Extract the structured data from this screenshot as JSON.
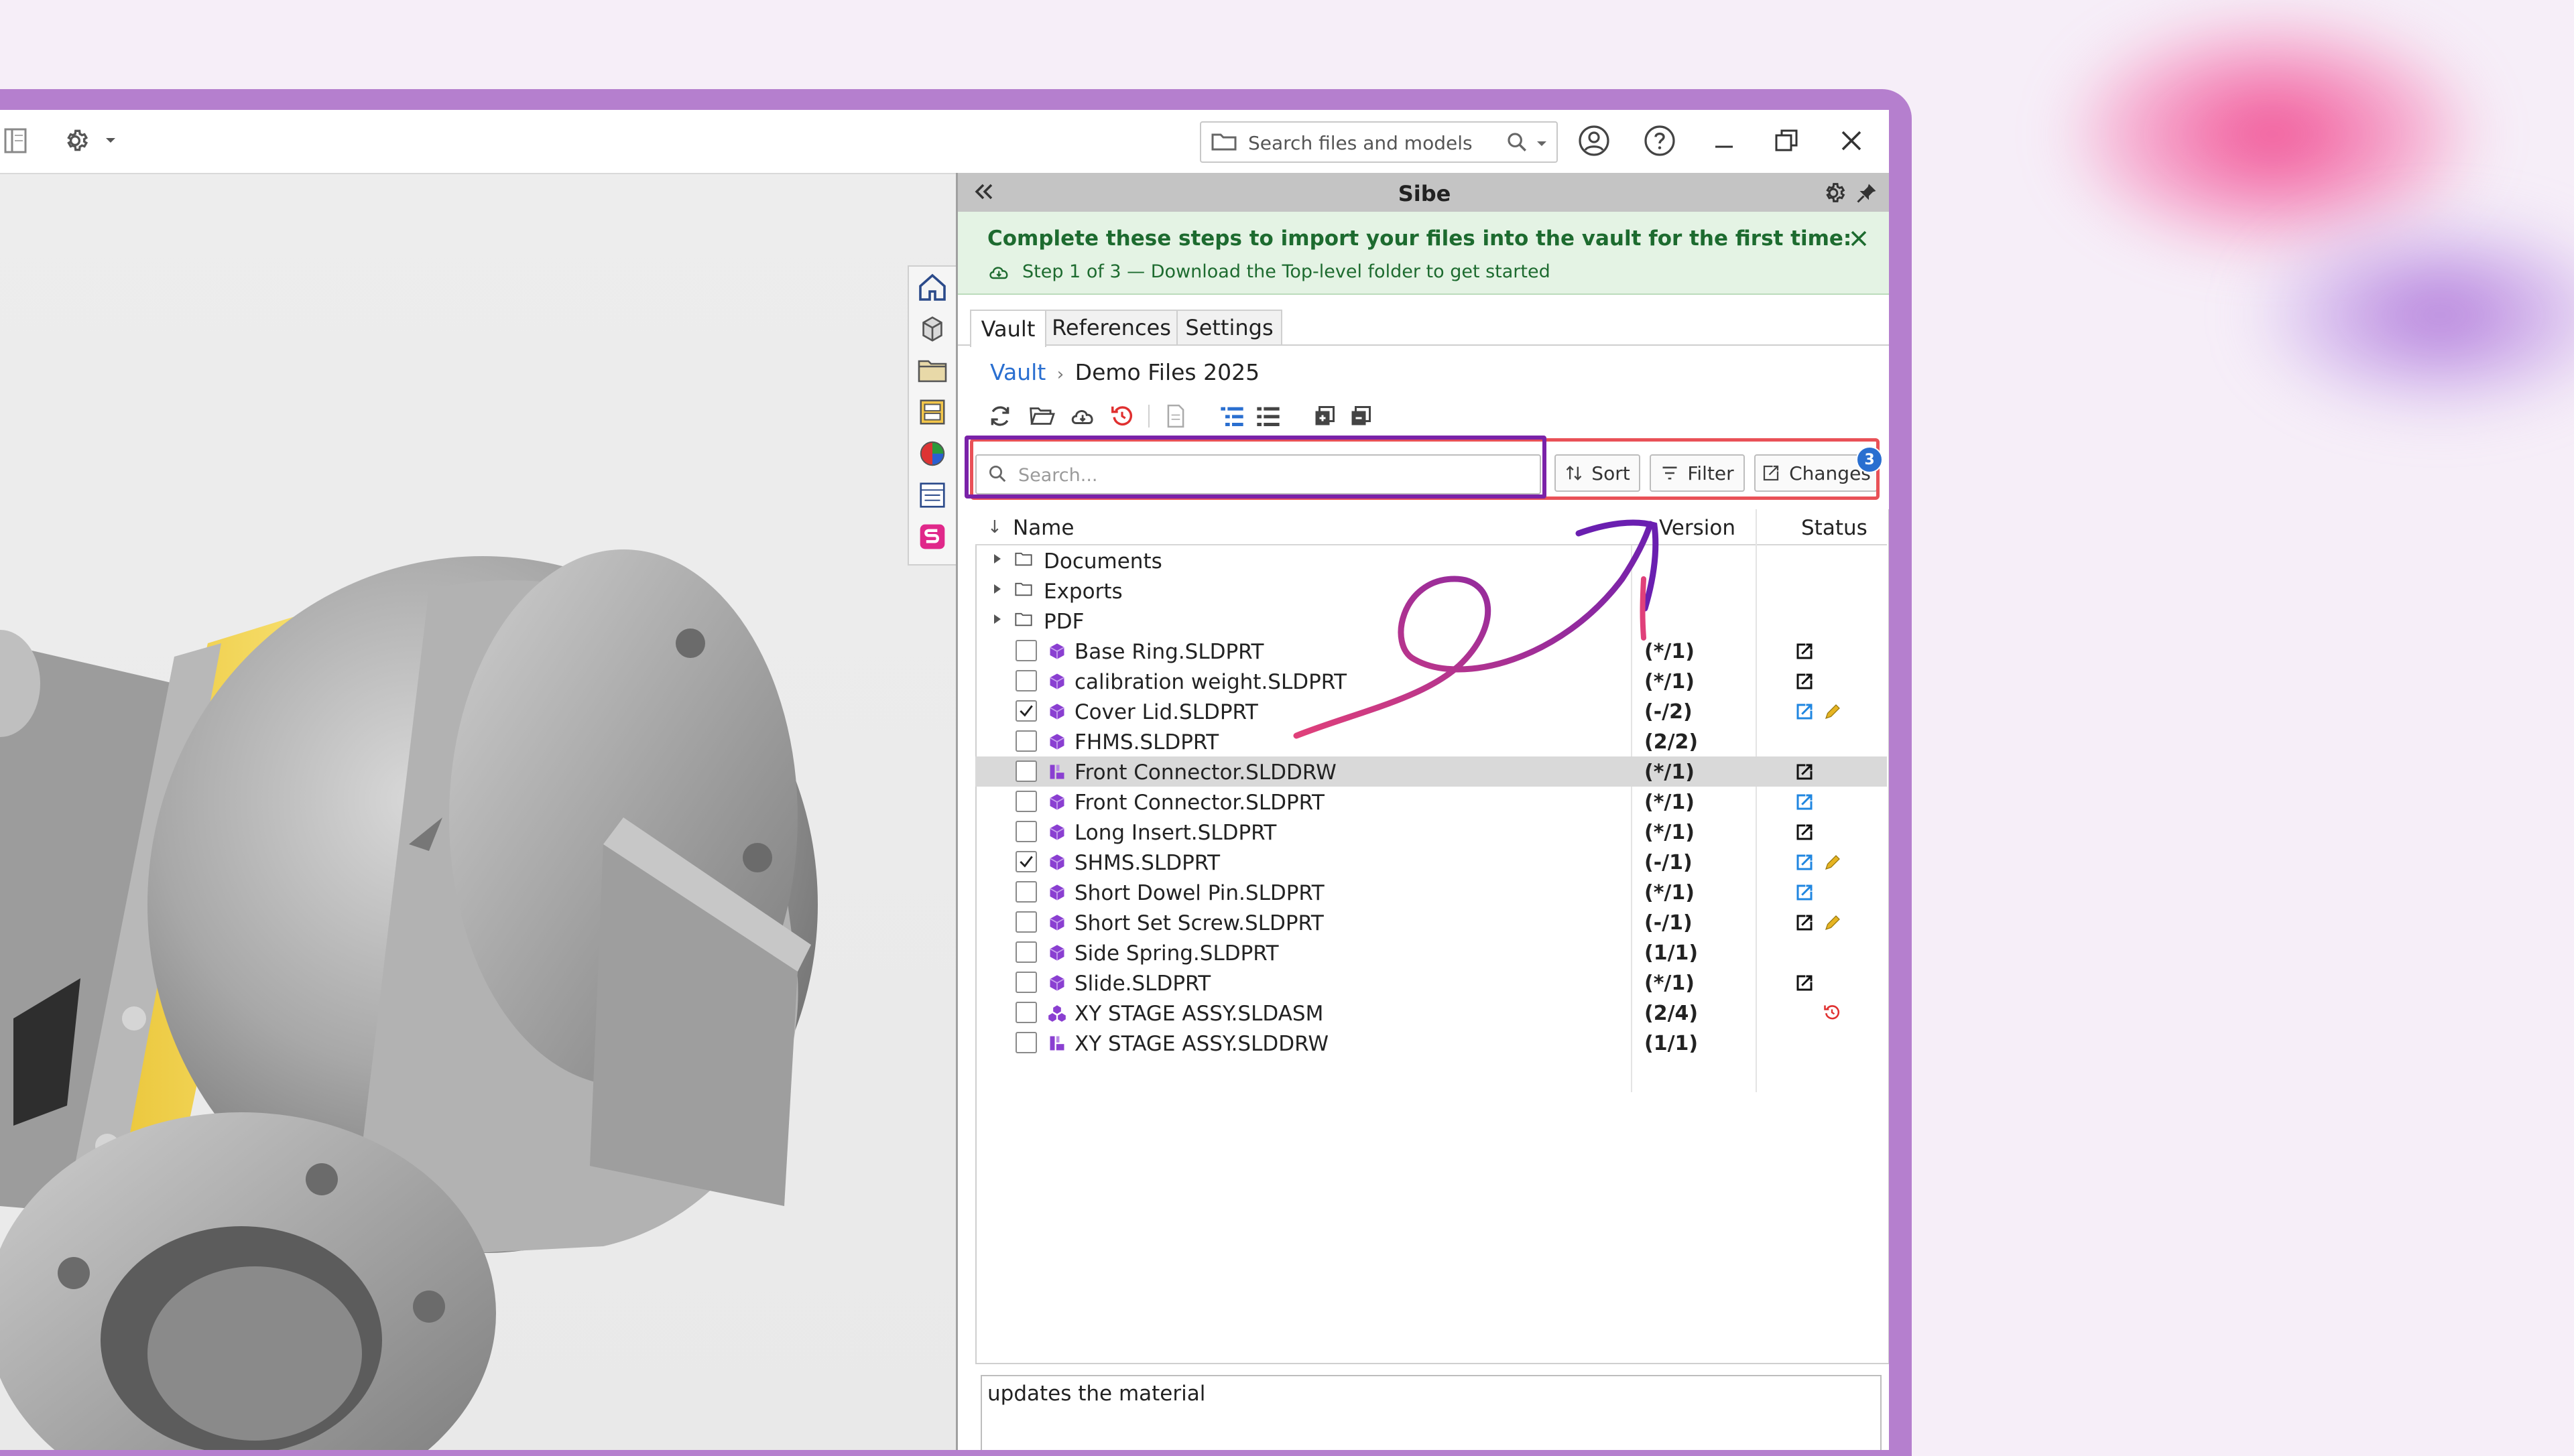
{
  "topbar": {
    "search_placeholder": "Search files and models"
  },
  "panel": {
    "title": "Sibe",
    "banner": {
      "headline": "Complete these steps to import your files into the vault for the first time:",
      "step": "Step 1 of 3 — Download the Top-level folder to get started"
    },
    "tabs": [
      "Vault",
      "References",
      "Settings"
    ],
    "active_tab": "Vault",
    "breadcrumb": {
      "root": "Vault",
      "separator": "›",
      "current": "Demo Files 2025"
    },
    "filter": {
      "search_placeholder": "Search...",
      "sort_label": "Sort",
      "filter_label": "Filter",
      "changes_label": "Changes",
      "changes_count": "3"
    },
    "columns": {
      "name": "Name",
      "version": "Version",
      "status": "Status"
    },
    "folders": [
      "Documents",
      "Exports",
      "PDF"
    ],
    "files": [
      {
        "name": "Base Ring.SLDPRT",
        "version": "(*/1)",
        "checked": false,
        "type": "part",
        "status": [
          "export"
        ]
      },
      {
        "name": "calibration weight.SLDPRT",
        "version": "(*/1)",
        "checked": false,
        "type": "part",
        "status": [
          "export"
        ]
      },
      {
        "name": "Cover Lid.SLDPRT",
        "version": "(-/2)",
        "checked": true,
        "type": "part",
        "status": [
          "export-blue",
          "pencil"
        ]
      },
      {
        "name": "FHMS.SLDPRT",
        "version": "(2/2)",
        "checked": false,
        "type": "part",
        "status": []
      },
      {
        "name": "Front Connector.SLDDRW",
        "version": "(*/1)",
        "checked": false,
        "type": "drawing",
        "status": [
          "export"
        ],
        "selected": true
      },
      {
        "name": "Front Connector.SLDPRT",
        "version": "(*/1)",
        "checked": false,
        "type": "part",
        "status": [
          "export-blue"
        ]
      },
      {
        "name": "Long Insert.SLDPRT",
        "version": "(*/1)",
        "checked": false,
        "type": "part",
        "status": [
          "export"
        ]
      },
      {
        "name": "SHMS.SLDPRT",
        "version": "(-/1)",
        "checked": true,
        "type": "part",
        "status": [
          "export-blue",
          "pencil"
        ]
      },
      {
        "name": "Short Dowel Pin.SLDPRT",
        "version": "(*/1)",
        "checked": false,
        "type": "part",
        "status": [
          "export-blue"
        ]
      },
      {
        "name": "Short Set Screw.SLDPRT",
        "version": "(-/1)",
        "checked": false,
        "type": "part",
        "status": [
          "export",
          "pencil"
        ]
      },
      {
        "name": "Side Spring.SLDPRT",
        "version": "(1/1)",
        "checked": false,
        "type": "part",
        "status": []
      },
      {
        "name": "Slide.SLDPRT",
        "version": "(*/1)",
        "checked": false,
        "type": "part",
        "status": [
          "export"
        ]
      },
      {
        "name": "XY STAGE ASSY.SLDASM",
        "version": "(2/4)",
        "checked": false,
        "type": "assembly",
        "status": [
          "revert"
        ]
      },
      {
        "name": "XY STAGE ASSY.SLDDRW",
        "version": "(1/1)",
        "checked": false,
        "type": "drawing",
        "status": []
      }
    ],
    "comment": "updates the material"
  },
  "colors": {
    "accent_purple": "#7a22a8",
    "highlight_red": "#e95157",
    "banner_green": "#1d6b2f",
    "link_blue": "#2a6fd0",
    "part_icon": "#8a3fd1"
  }
}
